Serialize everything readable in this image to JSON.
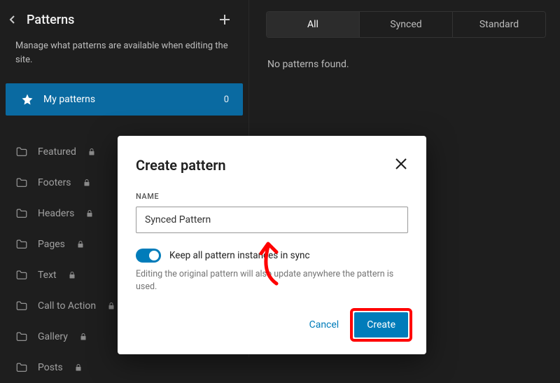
{
  "sidebar": {
    "title": "Patterns",
    "description": "Manage what patterns are available when editing the site.",
    "my_patterns_label": "My patterns",
    "my_patterns_count": "0",
    "categories": [
      {
        "label": "Featured",
        "locked": true
      },
      {
        "label": "Footers",
        "locked": true
      },
      {
        "label": "Headers",
        "locked": true
      },
      {
        "label": "Pages",
        "locked": true
      },
      {
        "label": "Text",
        "locked": true
      },
      {
        "label": "Call to Action",
        "locked": true
      },
      {
        "label": "Gallery",
        "locked": true
      },
      {
        "label": "Posts",
        "locked": true
      }
    ]
  },
  "main": {
    "tabs": {
      "all": "All",
      "synced": "Synced",
      "standard": "Standard"
    },
    "empty": "No patterns found."
  },
  "modal": {
    "title": "Create pattern",
    "name_label": "NAME",
    "name_value": "Synced Pattern",
    "sync_toggle_label": "Keep all pattern instances in sync",
    "sync_help": "Editing the original pattern will also update anywhere the pattern is used.",
    "cancel": "Cancel",
    "create": "Create"
  }
}
